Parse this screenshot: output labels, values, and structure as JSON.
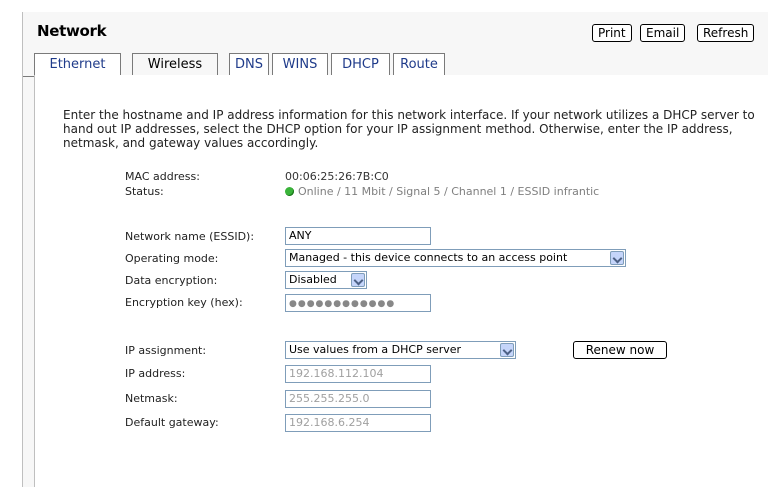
{
  "header": {
    "title": "Network"
  },
  "toolbar": {
    "print": "Print",
    "email": "Email",
    "refresh": "Refresh"
  },
  "tabs": [
    {
      "label": "Ethernet"
    },
    {
      "label": "Wireless"
    },
    {
      "label": "DNS"
    },
    {
      "label": "WINS"
    },
    {
      "label": "DHCP"
    },
    {
      "label": "Route"
    }
  ],
  "intro": "Enter the hostname and IP address information for this network interface. If your network utilizes a DHCP server to hand out IP addresses, select the DHCP option for your IP assignment method. Otherwise, enter the IP address, netmask, and gateway values accordingly.",
  "mac": {
    "label": "MAC address:",
    "value": "00:06:25:26:7B:C0"
  },
  "status": {
    "label": "Status:",
    "value": "Online / 11 Mbit / Signal 5 / Channel 1 / ESSID infrantic",
    "indicator_color": "#3ab43a"
  },
  "essid": {
    "label": "Network name (ESSID):",
    "value": "ANY"
  },
  "mode": {
    "label": "Operating mode:",
    "selected": "Managed - this device connects to an access point"
  },
  "encryption": {
    "label": "Data encryption:",
    "selected": "Disabled"
  },
  "key": {
    "label": "Encryption key (hex):",
    "masked": "●●●●●●●●●●●●"
  },
  "ipassign": {
    "label": "IP assignment:",
    "selected": "Use values from a DHCP server",
    "renew": "Renew now"
  },
  "ip": {
    "label": "IP address:",
    "value": "192.168.112.104"
  },
  "netmask": {
    "label": "Netmask:",
    "value": "255.255.255.0"
  },
  "gateway": {
    "label": "Default gateway:",
    "value": "192.168.6.254"
  }
}
